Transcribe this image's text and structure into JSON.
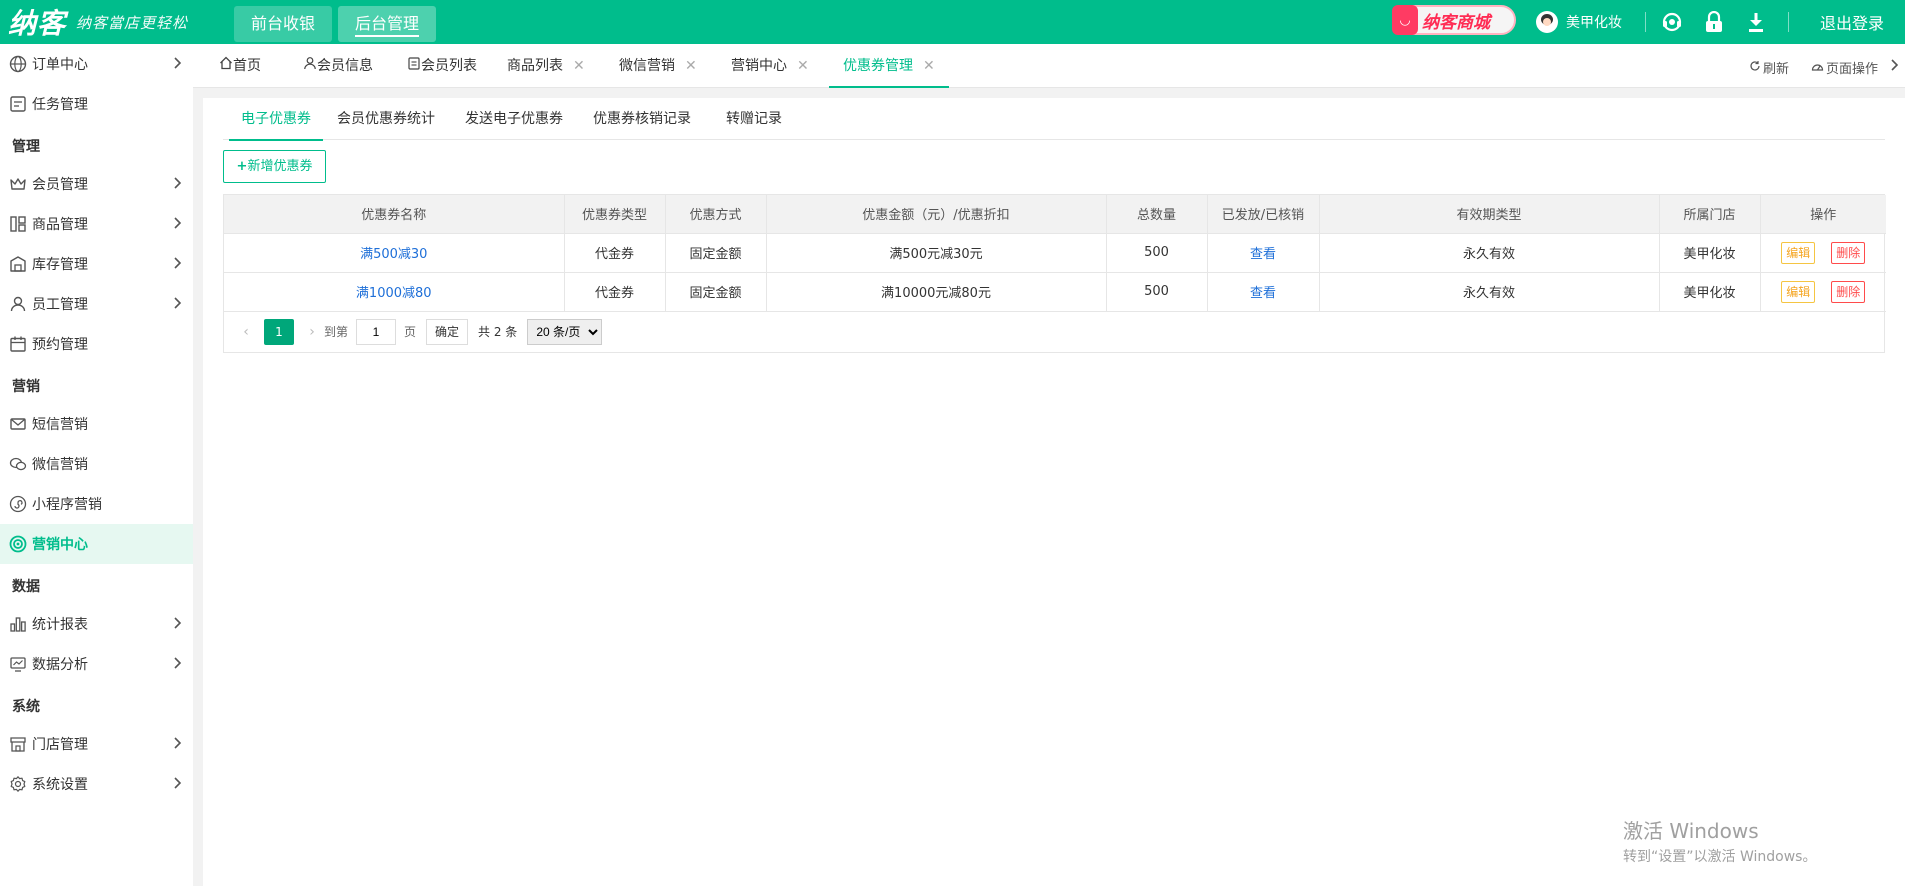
{
  "brand": {
    "logo": "纳客",
    "slogan": "纳客當店更轻松"
  },
  "top_nav": [
    {
      "label": "前台收银"
    },
    {
      "label": "后台管理"
    }
  ],
  "mall": {
    "label": "纳客商城"
  },
  "user": {
    "name": "美甲化妆"
  },
  "logout_label": "退出登录",
  "sidebar": {
    "items": [
      {
        "label": "订单中心"
      },
      {
        "label": "任务管理"
      },
      {
        "label": "会员管理"
      },
      {
        "label": "商品管理"
      },
      {
        "label": "库存管理"
      },
      {
        "label": "员工管理"
      },
      {
        "label": "预约管理"
      },
      {
        "label": "短信营销"
      },
      {
        "label": "微信营销"
      },
      {
        "label": "小程序营销"
      },
      {
        "label": "营销中心"
      },
      {
        "label": "统计报表"
      },
      {
        "label": "数据分析"
      },
      {
        "label": "门店管理"
      },
      {
        "label": "系统设置"
      }
    ],
    "groups": [
      "管理",
      "营销",
      "数据",
      "系统"
    ]
  },
  "tabs": [
    {
      "label": "首页"
    },
    {
      "label": "会员信息"
    },
    {
      "label": "会员列表"
    },
    {
      "label": "商品列表"
    },
    {
      "label": "微信营销"
    },
    {
      "label": "营销中心"
    },
    {
      "label": "优惠券管理"
    }
  ],
  "tab_actions": {
    "refresh": "刷新",
    "page_ops": "页面操作"
  },
  "subtabs": [
    "电子优惠券",
    "会员优惠券统计",
    "发送电子优惠券",
    "优惠券核销记录",
    "转赠记录"
  ],
  "add_button": "新增优惠券",
  "table": {
    "headers": [
      "优惠券名称",
      "优惠券类型",
      "优惠方式",
      "优惠金额（元）/优惠折扣",
      "总数量",
      "已发放/已核销",
      "有效期类型",
      "所属门店",
      "操作"
    ],
    "rows": [
      {
        "name": "满500减30",
        "type": "代金券",
        "method": "固定金额",
        "amount": "满500元减30元",
        "total": "500",
        "issued": "查看",
        "validity": "永久有效",
        "store": "美甲化妆",
        "edit": "编辑",
        "delete": "删除"
      },
      {
        "name": "满1000减80",
        "type": "代金券",
        "method": "固定金额",
        "amount": "满10000元减80元",
        "total": "500",
        "issued": "查看",
        "validity": "永久有效",
        "store": "美甲化妆",
        "edit": "编辑",
        "delete": "删除"
      }
    ]
  },
  "pager": {
    "current": "1",
    "goto_label": "到第",
    "goto_value": "1",
    "page_unit": "页",
    "confirm": "确定",
    "total": "共 2 条",
    "page_size": "20 条/页"
  },
  "watermark": {
    "title": "激活 Windows",
    "subtitle": "转到“设置”以激活 Windows。"
  },
  "colors": {
    "brand": "#00bd8c",
    "link": "#1e6fd8",
    "edit": "#f5a623",
    "delete": "#ff4b4b"
  }
}
